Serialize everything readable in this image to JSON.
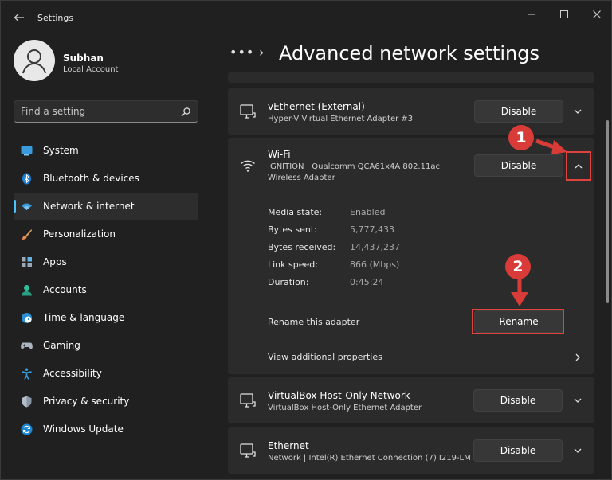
{
  "app": {
    "title": "Settings"
  },
  "window_controls": {
    "minimize": "—",
    "maximize": "☐",
    "close": "✕"
  },
  "profile": {
    "name": "Subhan",
    "account_type": "Local Account"
  },
  "search": {
    "placeholder": "Find a setting"
  },
  "sidebar": {
    "items": [
      {
        "label": "System",
        "icon": "system-icon"
      },
      {
        "label": "Bluetooth & devices",
        "icon": "bluetooth-icon"
      },
      {
        "label": "Network & internet",
        "icon": "network-icon",
        "active": true
      },
      {
        "label": "Personalization",
        "icon": "brush-icon"
      },
      {
        "label": "Apps",
        "icon": "apps-icon"
      },
      {
        "label": "Accounts",
        "icon": "accounts-icon"
      },
      {
        "label": "Time & language",
        "icon": "globe-clock-icon"
      },
      {
        "label": "Gaming",
        "icon": "gamepad-icon"
      },
      {
        "label": "Accessibility",
        "icon": "accessibility-icon"
      },
      {
        "label": "Privacy & security",
        "icon": "shield-icon"
      },
      {
        "label": "Windows Update",
        "icon": "update-icon"
      }
    ]
  },
  "breadcrumb": {
    "overflow": "•••",
    "separator": "›",
    "title": "Advanced network settings"
  },
  "adapters": {
    "vethernet": {
      "name": "vEthernet (External)",
      "description": "Hyper-V Virtual Ethernet Adapter #3",
      "button": "Disable"
    },
    "wifi": {
      "name": "Wi-Fi",
      "description": "IGNITION | Qualcomm QCA61x4A 802.11ac",
      "type": "Wireless Adapter",
      "button": "Disable",
      "details": [
        {
          "label": "Media state:",
          "value": "Enabled"
        },
        {
          "label": "Bytes sent:",
          "value": "5,777,433"
        },
        {
          "label": "Bytes received:",
          "value": "14,437,237"
        },
        {
          "label": "Link speed:",
          "value": "866 (Mbps)"
        },
        {
          "label": "Duration:",
          "value": "0:45:24"
        }
      ],
      "rename_label": "Rename this adapter",
      "rename_button": "Rename",
      "view_properties": "View additional properties"
    },
    "virtualbox": {
      "name": "VirtualBox Host-Only Network",
      "description": "VirtualBox Host-Only Ethernet Adapter",
      "button": "Disable"
    },
    "ethernet": {
      "name": "Ethernet",
      "description": "Network | Intel(R) Ethernet Connection (7) I219-LM",
      "button": "Disable"
    }
  },
  "annotations": {
    "step1": "1",
    "step2": "2"
  },
  "colors": {
    "accent": "#4cc2ff",
    "annotation_red": "#d83b38",
    "background": "#202020",
    "card": "#2b2b2b"
  }
}
